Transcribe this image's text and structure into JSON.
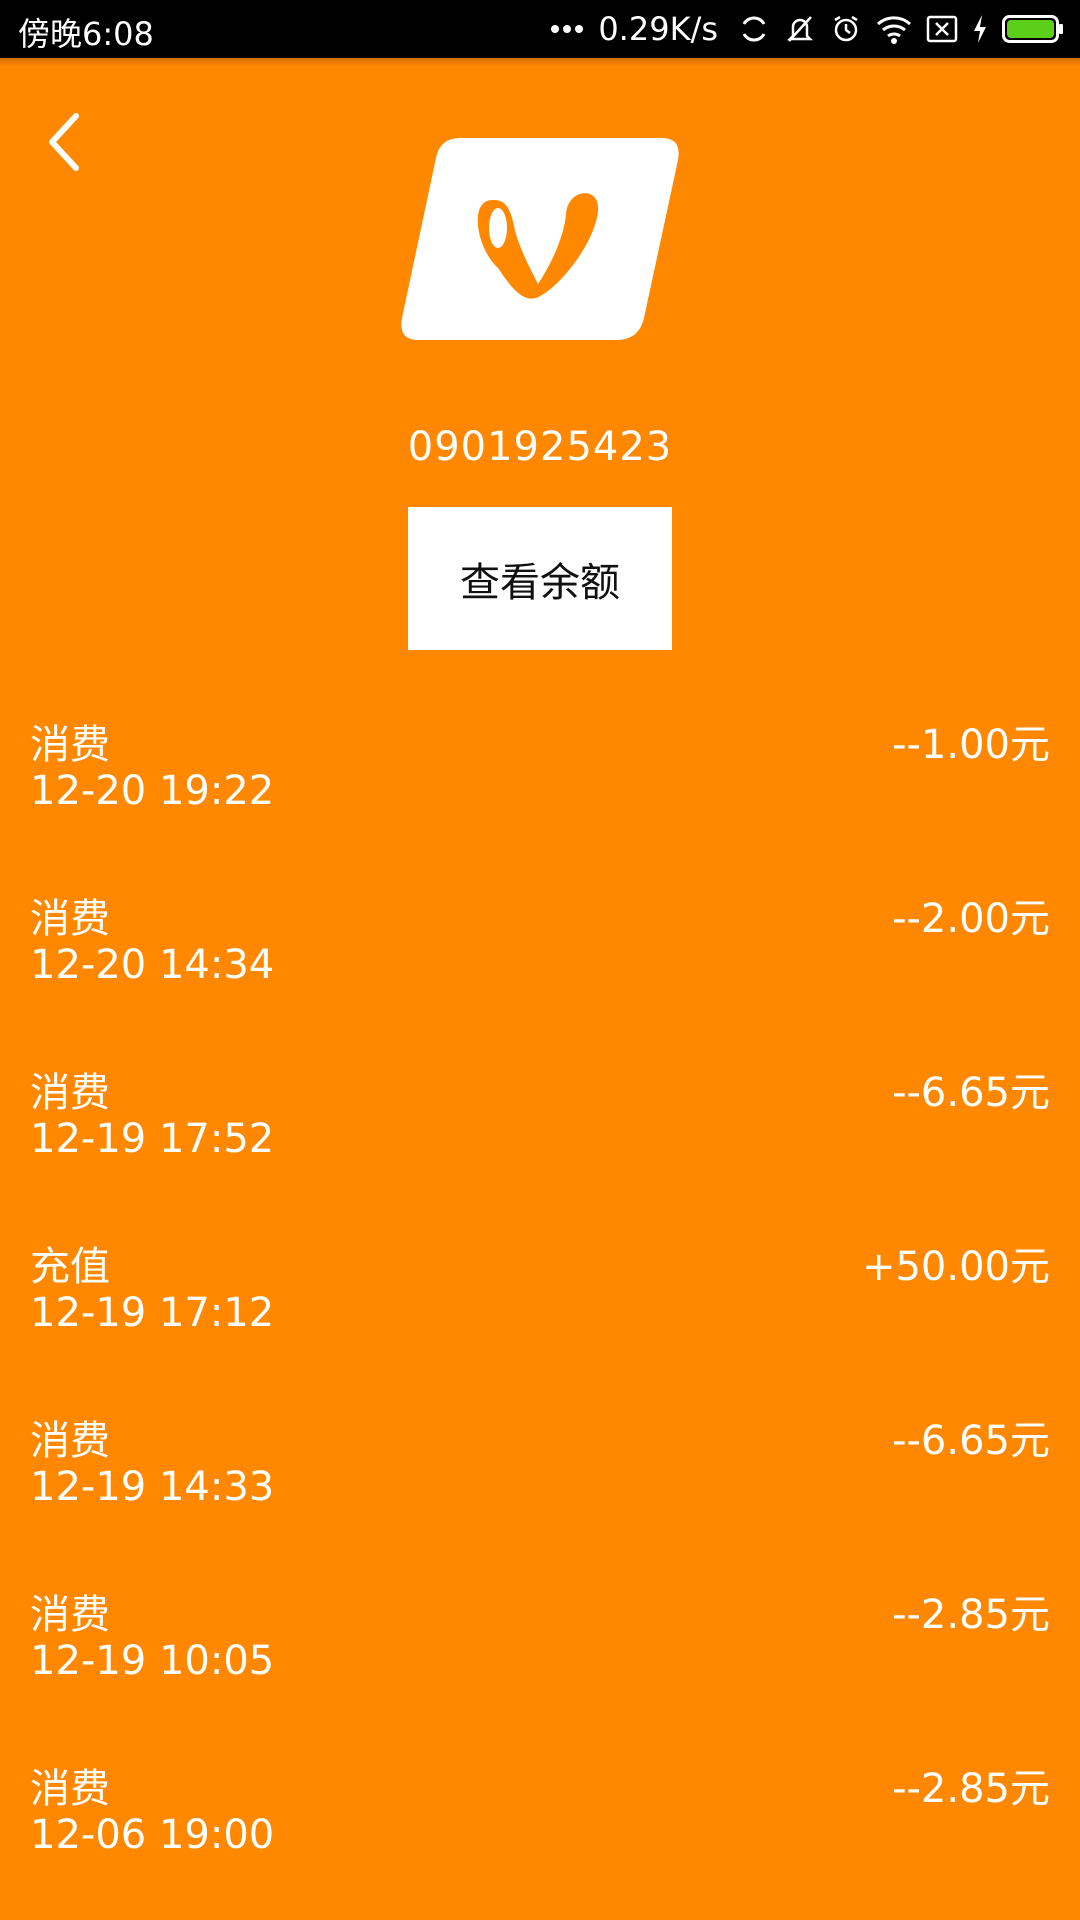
{
  "status_bar": {
    "time": "傍晚6:08",
    "net_speed": "0.29K/s"
  },
  "header": {
    "card_number": "0901925423",
    "balance_button": "查看余额"
  },
  "transactions": [
    {
      "type": "消费",
      "time": "12-20 19:22",
      "amount": "--1.00元"
    },
    {
      "type": "消费",
      "time": "12-20 14:34",
      "amount": "--2.00元"
    },
    {
      "type": "消费",
      "time": "12-19 17:52",
      "amount": "--6.65元"
    },
    {
      "type": "充值",
      "time": "12-19 17:12",
      "amount": "+50.00元"
    },
    {
      "type": "消费",
      "time": "12-19 14:33",
      "amount": "--6.65元"
    },
    {
      "type": "消费",
      "time": "12-19 10:05",
      "amount": "--2.85元"
    },
    {
      "type": "消费",
      "time": "12-06 19:00",
      "amount": "--2.85元"
    }
  ],
  "colors": {
    "background": "#ff8800",
    "battery": "#5ccf1a"
  }
}
